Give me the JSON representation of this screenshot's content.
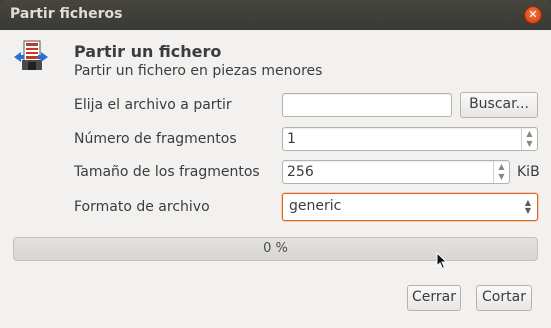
{
  "window": {
    "title": "Partir ficheros",
    "close_icon": "close-icon",
    "colors": {
      "titlebar": "#3c3b37",
      "close": "#dd4814",
      "focus": "#e0631a",
      "dialog_bg": "#f2f1f0"
    }
  },
  "header": {
    "icon": "file-split-icon",
    "title": "Partir un fichero",
    "subtitle": "Partir un fichero en piezas menores"
  },
  "form": {
    "file": {
      "label": "Elija el archivo a partir",
      "value": "",
      "browse_label": "Buscar..."
    },
    "fragments": {
      "label": "Número de fragmentos",
      "value": "1"
    },
    "size": {
      "label": "Tamaño de los fragmentos",
      "value": "256",
      "unit": "KiB"
    },
    "format": {
      "label": "Formato de archivo",
      "value": "generic"
    }
  },
  "progress": {
    "text": "0 %",
    "value": 0
  },
  "buttons": {
    "close_label": "Cerrar",
    "split_label": "Cortar"
  }
}
